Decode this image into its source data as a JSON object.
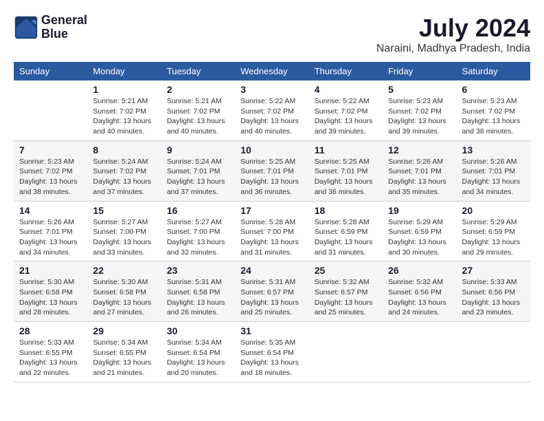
{
  "logo": {
    "line1": "General",
    "line2": "Blue"
  },
  "title": "July 2024",
  "subtitle": "Naraini, Madhya Pradesh, India",
  "days_header": [
    "Sunday",
    "Monday",
    "Tuesday",
    "Wednesday",
    "Thursday",
    "Friday",
    "Saturday"
  ],
  "weeks": [
    [
      {
        "num": "",
        "info": ""
      },
      {
        "num": "1",
        "info": "Sunrise: 5:21 AM\nSunset: 7:02 PM\nDaylight: 13 hours\nand 40 minutes."
      },
      {
        "num": "2",
        "info": "Sunrise: 5:21 AM\nSunset: 7:02 PM\nDaylight: 13 hours\nand 40 minutes."
      },
      {
        "num": "3",
        "info": "Sunrise: 5:22 AM\nSunset: 7:02 PM\nDaylight: 13 hours\nand 40 minutes."
      },
      {
        "num": "4",
        "info": "Sunrise: 5:22 AM\nSunset: 7:02 PM\nDaylight: 13 hours\nand 39 minutes."
      },
      {
        "num": "5",
        "info": "Sunrise: 5:23 AM\nSunset: 7:02 PM\nDaylight: 13 hours\nand 39 minutes."
      },
      {
        "num": "6",
        "info": "Sunrise: 5:23 AM\nSunset: 7:02 PM\nDaylight: 13 hours\nand 38 minutes."
      }
    ],
    [
      {
        "num": "7",
        "info": "Sunrise: 5:23 AM\nSunset: 7:02 PM\nDaylight: 13 hours\nand 38 minutes."
      },
      {
        "num": "8",
        "info": "Sunrise: 5:24 AM\nSunset: 7:02 PM\nDaylight: 13 hours\nand 37 minutes."
      },
      {
        "num": "9",
        "info": "Sunrise: 5:24 AM\nSunset: 7:01 PM\nDaylight: 13 hours\nand 37 minutes."
      },
      {
        "num": "10",
        "info": "Sunrise: 5:25 AM\nSunset: 7:01 PM\nDaylight: 13 hours\nand 36 minutes."
      },
      {
        "num": "11",
        "info": "Sunrise: 5:25 AM\nSunset: 7:01 PM\nDaylight: 13 hours\nand 36 minutes."
      },
      {
        "num": "12",
        "info": "Sunrise: 5:26 AM\nSunset: 7:01 PM\nDaylight: 13 hours\nand 35 minutes."
      },
      {
        "num": "13",
        "info": "Sunrise: 5:26 AM\nSunset: 7:01 PM\nDaylight: 13 hours\nand 34 minutes."
      }
    ],
    [
      {
        "num": "14",
        "info": "Sunrise: 5:26 AM\nSunset: 7:01 PM\nDaylight: 13 hours\nand 34 minutes."
      },
      {
        "num": "15",
        "info": "Sunrise: 5:27 AM\nSunset: 7:00 PM\nDaylight: 13 hours\nand 33 minutes."
      },
      {
        "num": "16",
        "info": "Sunrise: 5:27 AM\nSunset: 7:00 PM\nDaylight: 13 hours\nand 32 minutes."
      },
      {
        "num": "17",
        "info": "Sunrise: 5:28 AM\nSunset: 7:00 PM\nDaylight: 13 hours\nand 31 minutes."
      },
      {
        "num": "18",
        "info": "Sunrise: 5:28 AM\nSunset: 6:59 PM\nDaylight: 13 hours\nand 31 minutes."
      },
      {
        "num": "19",
        "info": "Sunrise: 5:29 AM\nSunset: 6:59 PM\nDaylight: 13 hours\nand 30 minutes."
      },
      {
        "num": "20",
        "info": "Sunrise: 5:29 AM\nSunset: 6:59 PM\nDaylight: 13 hours\nand 29 minutes."
      }
    ],
    [
      {
        "num": "21",
        "info": "Sunrise: 5:30 AM\nSunset: 6:58 PM\nDaylight: 13 hours\nand 28 minutes."
      },
      {
        "num": "22",
        "info": "Sunrise: 5:30 AM\nSunset: 6:58 PM\nDaylight: 13 hours\nand 27 minutes."
      },
      {
        "num": "23",
        "info": "Sunrise: 5:31 AM\nSunset: 6:58 PM\nDaylight: 13 hours\nand 26 minutes."
      },
      {
        "num": "24",
        "info": "Sunrise: 5:31 AM\nSunset: 6:57 PM\nDaylight: 13 hours\nand 25 minutes."
      },
      {
        "num": "25",
        "info": "Sunrise: 5:32 AM\nSunset: 6:57 PM\nDaylight: 13 hours\nand 25 minutes."
      },
      {
        "num": "26",
        "info": "Sunrise: 5:32 AM\nSunset: 6:56 PM\nDaylight: 13 hours\nand 24 minutes."
      },
      {
        "num": "27",
        "info": "Sunrise: 5:33 AM\nSunset: 6:56 PM\nDaylight: 13 hours\nand 23 minutes."
      }
    ],
    [
      {
        "num": "28",
        "info": "Sunrise: 5:33 AM\nSunset: 6:55 PM\nDaylight: 13 hours\nand 22 minutes."
      },
      {
        "num": "29",
        "info": "Sunrise: 5:34 AM\nSunset: 6:55 PM\nDaylight: 13 hours\nand 21 minutes."
      },
      {
        "num": "30",
        "info": "Sunrise: 5:34 AM\nSunset: 6:54 PM\nDaylight: 13 hours\nand 20 minutes."
      },
      {
        "num": "31",
        "info": "Sunrise: 5:35 AM\nSunset: 6:54 PM\nDaylight: 13 hours\nand 18 minutes."
      },
      {
        "num": "",
        "info": ""
      },
      {
        "num": "",
        "info": ""
      },
      {
        "num": "",
        "info": ""
      }
    ]
  ]
}
